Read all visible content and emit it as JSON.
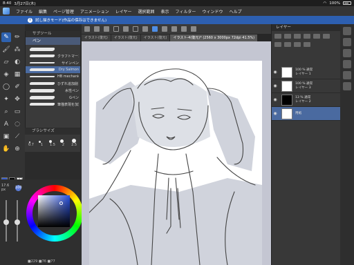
{
  "status": {
    "time": "8:40",
    "date": "3月27日(木)",
    "battery": "100%"
  },
  "menu": {
    "items": [
      "ファイル",
      "編集",
      "ページ管理",
      "アニメーション",
      "レイヤー",
      "選択範囲",
      "表示",
      "フィルター",
      "ウィンドウ",
      "ヘルプ"
    ]
  },
  "trial_banner": "試し描きモード(作品の保存はできません)",
  "tabs": [
    "イラスト(復元)",
    "イラスト(復元)",
    "イラスト(復元)",
    "イラスト-4(復元)* (2560 x 3000px 72dpi 41.5%)"
  ],
  "subtool": {
    "header": "サブツール",
    "tab_label": "ペン",
    "brushes": [
      {
        "label": "",
        "selected": false,
        "stroke": "thick"
      },
      {
        "label": "クラフトマーカー",
        "selected": false,
        "stroke": "normal"
      },
      {
        "label": "サインペン",
        "selected": false,
        "stroke": "thin"
      },
      {
        "label": "Dry Salmon",
        "selected": true,
        "stroke": "normal"
      },
      {
        "label": "HB mechanical pencil",
        "selected": false,
        "stroke": "thin"
      },
      {
        "label": "ひずれ追加削りメイク",
        "selected": false,
        "stroke": "normal"
      },
      {
        "label": "水性ペン",
        "selected": false,
        "stroke": "thick"
      },
      {
        "label": "Gペン",
        "selected": false,
        "stroke": "thick"
      },
      {
        "label": "筆描表現を加算す",
        "selected": false,
        "stroke": "normal"
      }
    ]
  },
  "brushsize": {
    "header": "ブラシサイズ",
    "sizes": [
      "0.7",
      "1",
      "1.5",
      "2",
      "2.5"
    ]
  },
  "color": {
    "size_value": "17.6",
    "size_unit": "px",
    "opacity_value": "100",
    "saturation": 0.73,
    "brightness": 0.73,
    "footer": "■229 ■76 ■77"
  },
  "layers": {
    "header": "レイヤー",
    "items": [
      {
        "mode": "100 % 通常",
        "name": "レイヤー 1",
        "visible": true,
        "selected": false
      },
      {
        "mode": "100 % 通常",
        "name": "レイヤー 3",
        "visible": true,
        "selected": false
      },
      {
        "mode": "13 % 通常",
        "name": "レイヤー 2",
        "visible": true,
        "selected": false
      },
      {
        "mode": "",
        "name": "用紙",
        "visible": true,
        "selected": true
      }
    ]
  },
  "colors": {
    "accent": "#2e62b0",
    "trial_banner_bg": "#2d5fb0",
    "canvas_bg": "#c4c6d2",
    "paper": "#ffffff",
    "main_color": "#3a5fd0"
  }
}
